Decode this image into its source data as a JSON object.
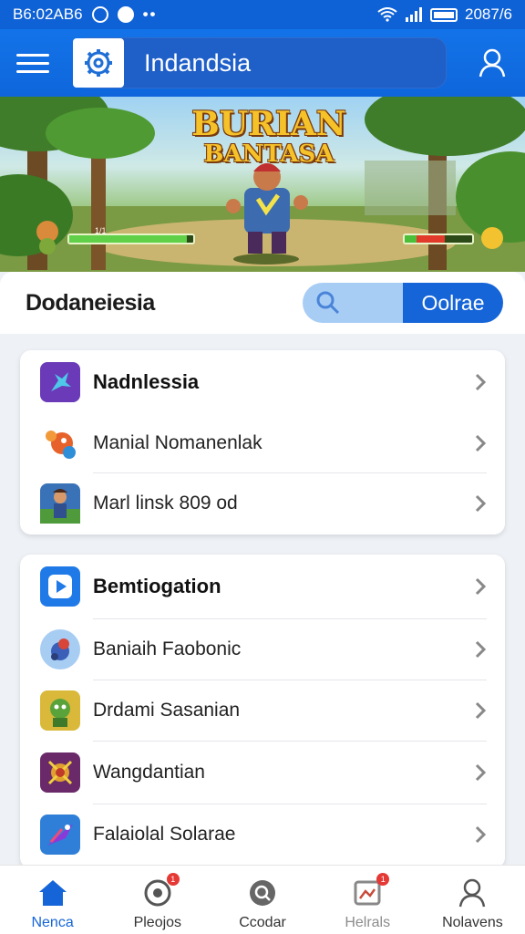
{
  "status_bar": {
    "time": "B6:02AB6",
    "right_text": "2087/6",
    "icons": [
      "whatsapp-icon",
      "chat-icon",
      "more-dots-icon",
      "wifi-icon",
      "signal-icon",
      "battery-icon"
    ]
  },
  "app_bar": {
    "title": "Indandsia",
    "menu_icon": "hamburger-icon",
    "logo_icon": "gear-logo-icon",
    "profile_icon": "profile-icon"
  },
  "banner": {
    "title_line1": "BURIAN",
    "title_line2": "BANTASA",
    "hp_left_label": "1/1",
    "hp_left_fill": 0.95,
    "hp_right_fill": 0.6
  },
  "header": {
    "title": "Dodaneiesia",
    "search_icon": "search-icon",
    "online_label": "Oolrae"
  },
  "card1": {
    "items": [
      {
        "label": "Nadnlessia",
        "icon": "game-app-icon",
        "bold": true
      },
      {
        "label": "Manial Nomanenlak",
        "icon": "dragon-icon",
        "bold": false
      },
      {
        "label": "Marl linsk 809 od",
        "icon": "hero-icon",
        "bold": false
      }
    ]
  },
  "card2": {
    "items": [
      {
        "label": "Bemtiogation",
        "icon": "play-icon",
        "bold": true
      },
      {
        "label": "Baniaih Faobonic",
        "icon": "creature-icon",
        "bold": false
      },
      {
        "label": "Drdami Sasanian",
        "icon": "goblin-icon",
        "bold": false
      },
      {
        "label": "Wangdantian",
        "icon": "warrior-icon",
        "bold": false
      },
      {
        "label": "Falaiolal Solarae",
        "icon": "jet-icon",
        "bold": false
      }
    ]
  },
  "bottom_nav": {
    "items": [
      {
        "label": "Nenca",
        "icon": "home-icon"
      },
      {
        "label": "Pleojos",
        "icon": "games-icon",
        "badge": "1"
      },
      {
        "label": "Ccodar",
        "icon": "search-globe-icon"
      },
      {
        "label": "Helrals",
        "icon": "gallery-icon",
        "badge": "1"
      },
      {
        "label": "Nolavens",
        "icon": "user-icon"
      }
    ]
  },
  "colors": {
    "primary": "#1565d8",
    "appbar": "#1373e8",
    "background": "#eef1f6"
  }
}
